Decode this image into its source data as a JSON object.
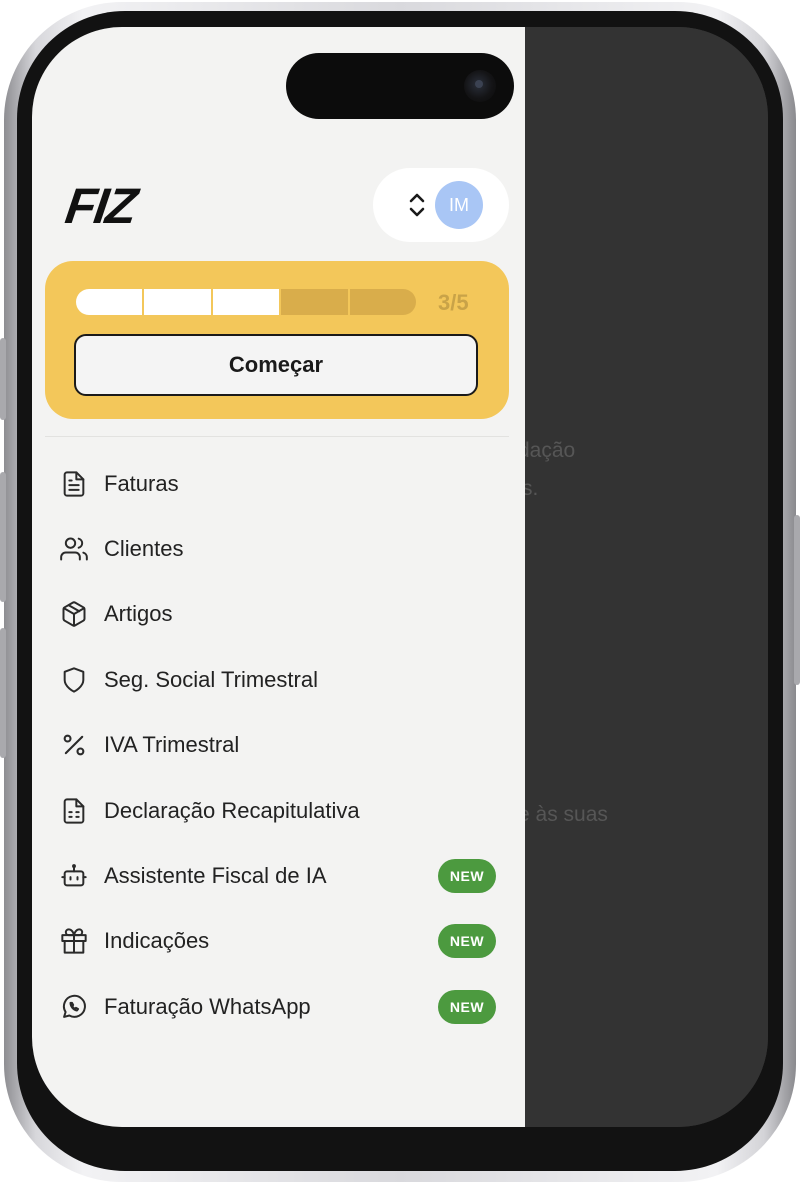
{
  "header": {
    "logo_text": "FIZ",
    "avatar_initials": "IM"
  },
  "onboarding": {
    "steps_total": 5,
    "steps_completed": 3,
    "progress_label": "3/5",
    "start_button_label": "Começar"
  },
  "nav": {
    "items": [
      {
        "label": "Faturas",
        "icon": "file-text-icon"
      },
      {
        "label": "Clientes",
        "icon": "users-icon"
      },
      {
        "label": "Artigos",
        "icon": "box-icon"
      },
      {
        "label": "Seg. Social Trimestral",
        "icon": "shield-icon"
      },
      {
        "label": "IVA Trimestral",
        "icon": "percent-icon"
      },
      {
        "label": "Declaração Recapitulativa",
        "icon": "file-spreadsheet-icon"
      },
      {
        "label": "Assistente Fiscal de IA",
        "icon": "bot-icon",
        "badge": "NEW"
      },
      {
        "label": "Indicações",
        "icon": "gift-icon",
        "badge": "NEW"
      },
      {
        "label": "Faturação WhatsApp",
        "icon": "whatsapp-icon",
        "badge": "NEW"
      }
    ]
  },
  "background_content": {
    "fragments": [
      "dação",
      "s.",
      "e às suas"
    ]
  },
  "colors": {
    "card_background": "#f3c75a",
    "badge_green": "#4c9a3f",
    "avatar_blue": "#a9c6f5",
    "drawer_background": "#f3f3f2",
    "overlay_dark": "#333333"
  }
}
